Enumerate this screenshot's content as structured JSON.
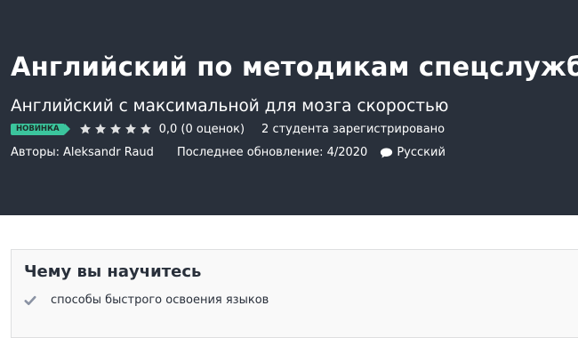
{
  "course": {
    "title": "Английский по методикам спецслужб",
    "subtitle": "Английский с максимальной для мозга скоростью",
    "badge": "НОВИНКА",
    "rating_value": 0.0,
    "rating_text": "0,0 (0 оценок)",
    "students_text": "2 студента зарегистрировано",
    "authors_label": "Авторы:",
    "author_name": "Aleksandr Raud",
    "last_updated": "Последнее обновление: 4/2020",
    "language": "Русский"
  },
  "learn": {
    "heading": "Чему вы научитесь",
    "items": [
      "способы быстрого освоения языков"
    ]
  },
  "icons": {
    "rating": "star-icon",
    "language": "speech-bubble-icon",
    "learn_item": "check-icon"
  },
  "colors": {
    "hero_background": "#29303b",
    "badge": "#3bc59d",
    "star_empty": "#dedfe0",
    "check": "#8a92a3"
  }
}
